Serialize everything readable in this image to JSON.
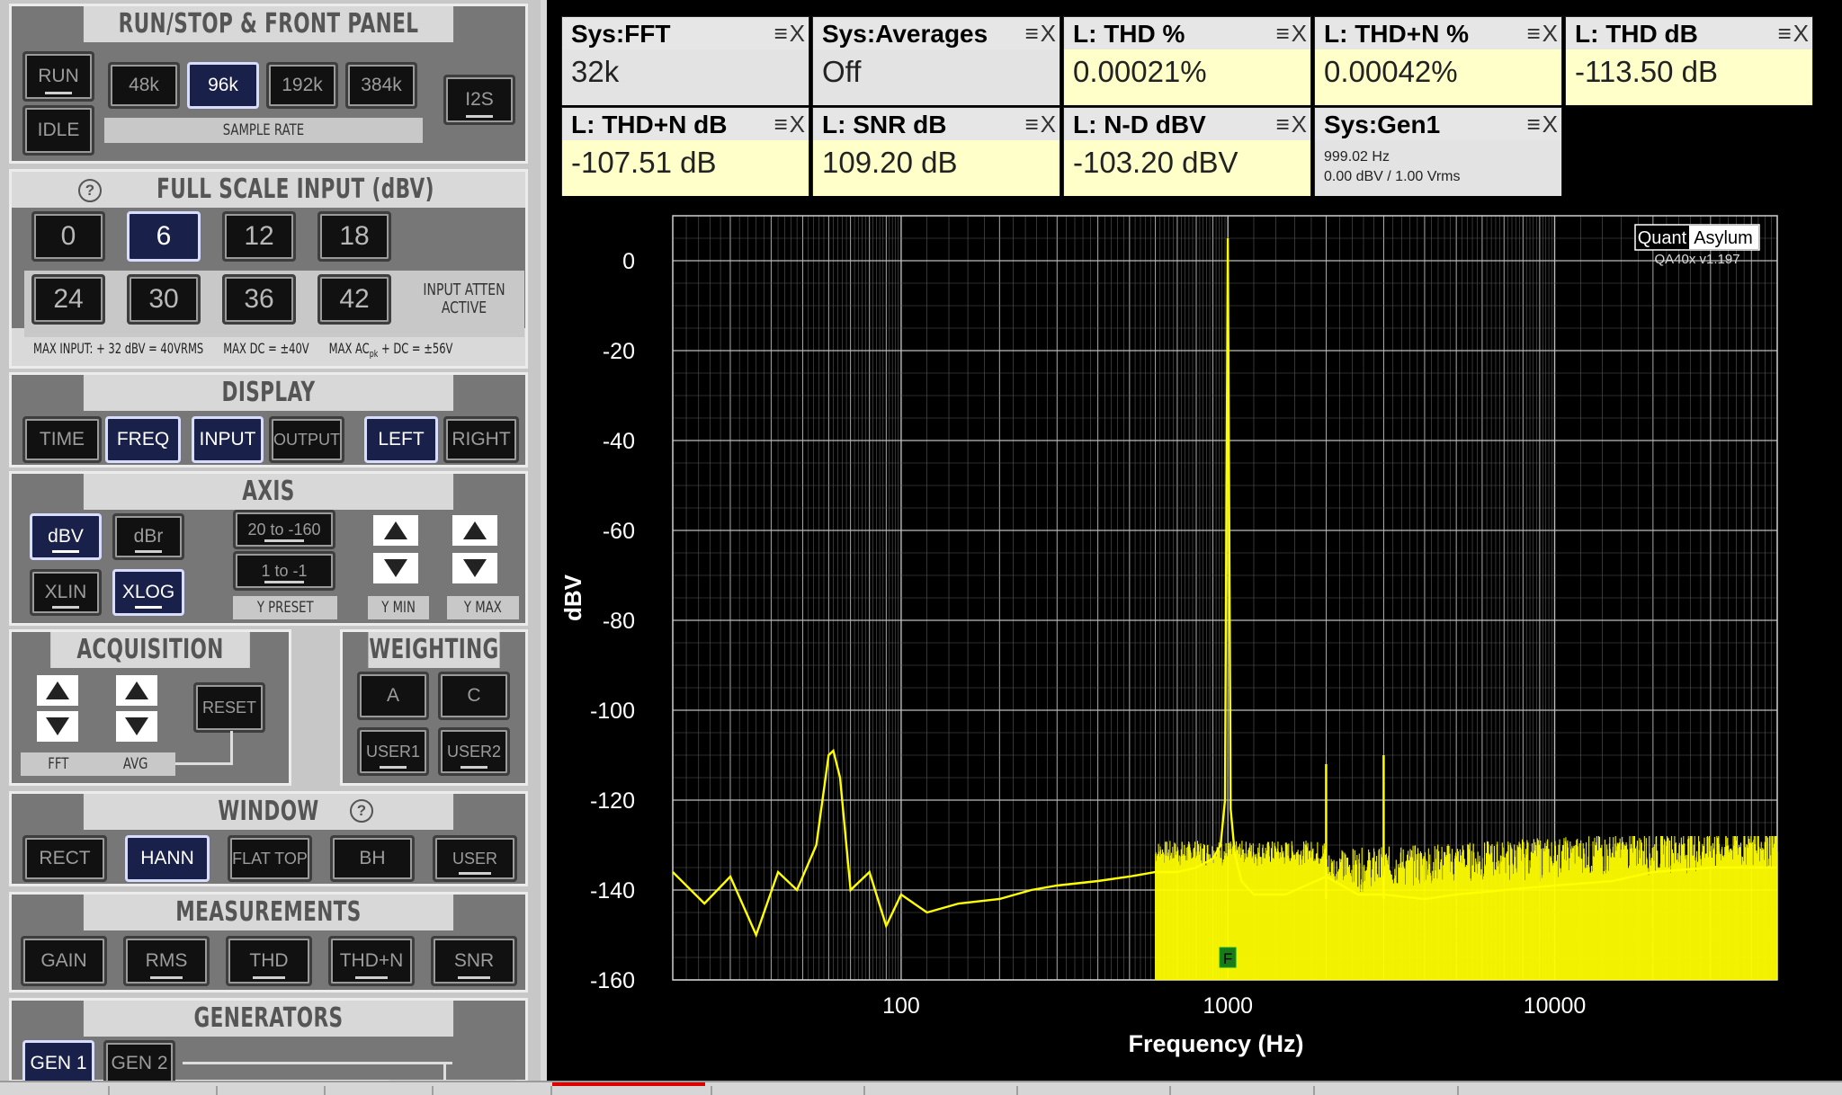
{
  "left_panel": {
    "run_stop": {
      "title": "RUN/STOP & FRONT PANEL",
      "run": "RUN",
      "idle": "IDLE",
      "rates": [
        "48k",
        "96k",
        "192k",
        "384k"
      ],
      "selected_rate": "96k",
      "rate_caption": "SAMPLE RATE",
      "i2s": "I2S"
    },
    "full_scale": {
      "title": "FULL SCALE INPUT (dBV)",
      "values": [
        "0",
        "6",
        "12",
        "18",
        "24",
        "30",
        "36",
        "42"
      ],
      "selected": "6",
      "atten_line1": "INPUT ATTEN",
      "atten_line2": "ACTIVE",
      "warning": "MAX INPUT: + 32 dBV = 40VRMS      MAX DC = ±40V      MAX AC",
      "warning_sub": "pk",
      "warning_tail": " + DC = ±56V"
    },
    "display": {
      "title": "DISPLAY",
      "buttons": [
        "TIME",
        "FREQ",
        "INPUT",
        "OUTPUT",
        "LEFT",
        "RIGHT"
      ]
    },
    "axis": {
      "title": "AXIS",
      "dbv": "dBV",
      "dbr": "dBr",
      "xlin": "XLIN",
      "xlog": "XLOG",
      "preset1": "20 to -160",
      "preset2": "1 to -1",
      "y_preset": "Y PRESET",
      "y_min": "Y MIN",
      "y_max": "Y MAX"
    },
    "acquisition": {
      "title": "ACQUISITION",
      "reset": "RESET",
      "fft": "FFT",
      "avg": "AVG"
    },
    "weighting": {
      "title": "WEIGHTING",
      "a": "A",
      "c": "C",
      "user1": "USER1",
      "user2": "USER2"
    },
    "window": {
      "title": "WINDOW",
      "buttons": [
        "RECT",
        "HANN",
        "FLAT TOP",
        "BH",
        "USER"
      ]
    },
    "measurements": {
      "title": "MEASUREMENTS",
      "buttons": [
        "GAIN",
        "RMS",
        "THD",
        "THD+N",
        "SNR"
      ]
    },
    "generators": {
      "title": "GENERATORS",
      "gen1": "GEN 1",
      "gen2": "GEN 2"
    }
  },
  "tiles": [
    {
      "title": "Sys:FFT",
      "value": "32k",
      "style": "gray"
    },
    {
      "title": "Sys:Averages",
      "value": "Off",
      "style": "gray"
    },
    {
      "title": "L: THD %",
      "value": "0.00021%",
      "style": "yellow"
    },
    {
      "title": "L: THD+N %",
      "value": "0.00042%",
      "style": "yellow"
    },
    {
      "title": "L: THD dB",
      "value": "-113.50 dB",
      "style": "yellow"
    },
    {
      "title": "L: THD+N dB",
      "value": "-107.51 dB",
      "style": "yellow"
    },
    {
      "title": "L: SNR dB",
      "value": "109.20 dB",
      "style": "yellow"
    },
    {
      "title": "L: N-D dBV",
      "value": "-103.20 dBV",
      "style": "yellow"
    },
    {
      "title": "Sys:Gen1",
      "value": "999.02 Hz",
      "value2": "0.00 dBV  / 1.00 Vrms",
      "style": "gray"
    }
  ],
  "chart_data": {
    "type": "line",
    "xlabel": "Frequency (Hz)",
    "ylabel": "dBV",
    "xscale": "log",
    "xlim": [
      20,
      48000
    ],
    "ylim": [
      -160,
      10
    ],
    "yticks": [
      0,
      -20,
      -40,
      -60,
      -80,
      -100,
      -120,
      -140,
      -160
    ],
    "xticks": [
      100,
      1000,
      10000
    ],
    "grid": true,
    "line_color": "#ffff00",
    "background": "#000000",
    "brand": "QuantAsylum",
    "brand_a": "Quant",
    "brand_b": "Asylum",
    "version": "QA40x v1.197",
    "marker_label": "F",
    "series": [
      {
        "x": [
          20,
          25,
          30,
          36,
          42,
          48,
          55,
          60,
          62,
          65,
          70,
          80,
          90,
          100,
          120,
          150,
          200,
          250,
          300,
          400,
          500,
          600,
          700,
          800,
          900,
          950,
          980,
          999,
          1020,
          1050,
          1100,
          1200,
          1500,
          2000,
          2500,
          3000,
          4000,
          5000,
          7000,
          10000,
          15000,
          20000,
          30000,
          40000,
          48000
        ],
        "y": [
          -136,
          -143,
          -137,
          -150,
          -136,
          -140,
          -130,
          -110,
          -109,
          -115,
          -140,
          -136,
          -148,
          -141,
          -145,
          -143,
          -142,
          -140,
          -139,
          -138,
          -137,
          -136,
          -136,
          -135,
          -133,
          -130,
          -120,
          5,
          -122,
          -132,
          -138,
          -141,
          -141,
          -137,
          -141,
          -141,
          -142,
          -141,
          -140,
          -139,
          -138,
          -136,
          -135,
          -135,
          -135
        ]
      },
      {
        "name_peaks": "harmonics",
        "x": [
          1998,
          2997
        ],
        "y": [
          -112,
          -110
        ]
      }
    ]
  },
  "colors": {
    "panel_bg": "#c7c7c7",
    "tile_yellow": "#ffffc9",
    "tile_gray": "#e3e3e3",
    "trace": "#ffff00"
  }
}
